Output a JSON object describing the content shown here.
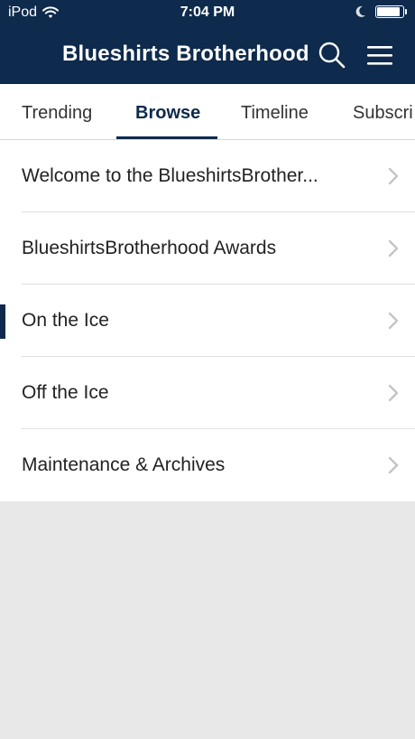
{
  "status_bar": {
    "carrier": "iPod",
    "time": "7:04 PM",
    "battery_level": 0.9
  },
  "nav": {
    "title": "Blueshirts Brotherhood",
    "search_icon": "search-icon",
    "menu_icon": "hamburger-menu-icon"
  },
  "tabs": [
    {
      "label": "Trending"
    },
    {
      "label": "Browse"
    },
    {
      "label": "Timeline"
    },
    {
      "label": "Subscri"
    }
  ],
  "active_tab": "Browse",
  "forums": [
    {
      "label": "Welcome to the BlueshirtsBrother..."
    },
    {
      "label": "BlueshirtsBrotherhood Awards"
    },
    {
      "label": "On the Ice"
    },
    {
      "label": "Off the Ice"
    },
    {
      "label": "Maintenance & Archives"
    }
  ],
  "colors": {
    "header_bg": "#0e2a4c",
    "accent": "#0e2a4c",
    "page_bg": "#e8e8e8"
  }
}
